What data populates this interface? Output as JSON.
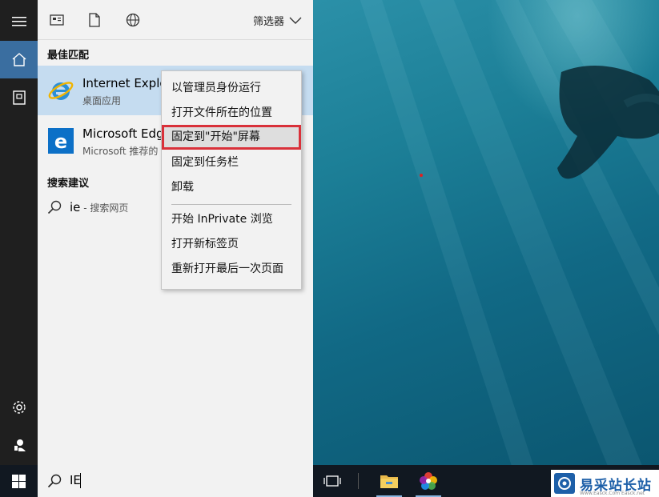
{
  "toolbar": {
    "filter_label": "筛选器",
    "icons": [
      "apps-icon",
      "document-icon",
      "web-icon"
    ]
  },
  "best_match": {
    "title": "最佳匹配",
    "results": [
      {
        "name": "Internet Explo",
        "sub": "桌面应用",
        "icon": "internet-explorer-icon"
      },
      {
        "name": "Microsoft Edg",
        "sub": "Microsoft 推荐的",
        "icon": "edge-icon"
      }
    ]
  },
  "suggestions": {
    "title": "搜索建议",
    "items": [
      {
        "query": "ie",
        "suffix": " - 搜索网页"
      }
    ]
  },
  "context_menu": {
    "items": [
      {
        "label": "以管理员身份运行"
      },
      {
        "label": "打开文件所在的位置"
      },
      {
        "label": "固定到\"开始\"屏幕"
      },
      {
        "label": "固定到任务栏"
      },
      {
        "label": "卸载"
      },
      {
        "label": "开始 InPrivate 浏览"
      },
      {
        "label": "打开新标签页"
      },
      {
        "label": "重新打开最后一次页面"
      }
    ],
    "highlighted_index": 2,
    "highlight_color": "#d9313a"
  },
  "search": {
    "value": "IE"
  },
  "rail": {
    "items": [
      "menu-icon",
      "home-icon",
      "device-icon",
      "settings-icon",
      "user-icon"
    ]
  },
  "taskbar": {
    "apps": [
      "task-view-icon",
      "file-explorer-icon",
      "photos-icon"
    ]
  },
  "watermark": {
    "text": "易采站长站",
    "sub": "Www.Easck.Com  Easck.net"
  },
  "colors": {
    "accent": "#3a6ea0",
    "selection": "#c5dcf0",
    "taskbar": "#111821"
  }
}
